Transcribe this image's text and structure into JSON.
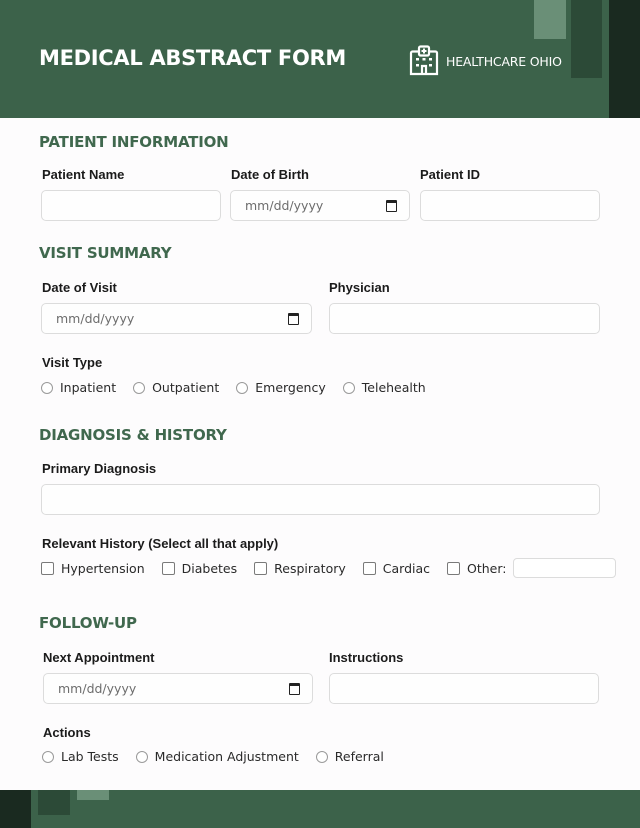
{
  "header": {
    "title": "MEDICAL ABSTRACT FORM",
    "brand_name": "HEALTHCARE OHIO",
    "brand_icon": "hospital-icon"
  },
  "colors": {
    "header_bg": "#3c624a",
    "accent_text": "#40684e",
    "dark_strip": "#1a2a20",
    "mid_block": "#2c4a37",
    "light_block": "#6a8f77"
  },
  "patient_info": {
    "title": "PATIENT INFORMATION",
    "name_label": "Patient Name",
    "name_value": "",
    "dob_label": "Date of Birth",
    "dob_placeholder": "mm/dd/yyyy",
    "id_label": "Patient ID",
    "id_value": ""
  },
  "visit_summary": {
    "title": "VISIT SUMMARY",
    "date_label": "Date of Visit",
    "date_placeholder": "mm/dd/yyyy",
    "physician_label": "Physician",
    "physician_value": "",
    "visit_type_label": "Visit Type",
    "visit_types": [
      "Inpatient",
      "Outpatient",
      "Emergency",
      "Telehealth"
    ]
  },
  "diagnosis": {
    "title": "DIAGNOSIS & HISTORY",
    "primary_label": "Primary Diagnosis",
    "primary_value": "",
    "history_label": "Relevant History (Select all that apply)",
    "history_options": [
      "Hypertension",
      "Diabetes",
      "Respiratory",
      "Cardiac",
      "Other:"
    ],
    "other_value": ""
  },
  "follow_up": {
    "title": "FOLLOW-UP",
    "next_label": "Next Appointment",
    "next_placeholder": "mm/dd/yyyy",
    "instructions_label": "Instructions",
    "instructions_value": "",
    "actions_label": "Actions",
    "actions": [
      "Lab Tests",
      "Medication Adjustment",
      "Referral"
    ]
  }
}
